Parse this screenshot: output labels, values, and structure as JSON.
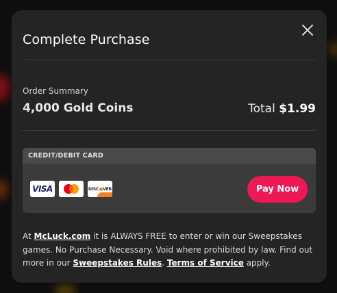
{
  "modal": {
    "title": "Complete Purchase",
    "close_icon": "close-icon"
  },
  "order": {
    "summary_label": "Order Summary",
    "product": "4,000 Gold Coins",
    "total_label": "Total",
    "total_amount": "$1.99"
  },
  "payment": {
    "method_label": "CREDIT/DEBIT CARD",
    "cards": [
      {
        "name": "visa",
        "text": "VISA",
        "icon": "visa-logo-icon"
      },
      {
        "name": "mastercard",
        "icon": "mastercard-logo-icon"
      },
      {
        "name": "discover",
        "text_a": "DISC",
        "text_b": "VER",
        "icon": "discover-logo-icon"
      }
    ],
    "pay_button": "Pay Now",
    "pay_button_color": "#ee1856"
  },
  "disclaimer": {
    "p1": "At ",
    "site_link": "McLuck.com",
    "p2": " it is ALWAYS FREE to enter or win our Sweepstakes games. No Purchase Necessary. Void where prohibited by law. Find out more in our ",
    "rules_link": "Sweepstakes Rules",
    "p3": ". ",
    "terms_link": "Terms of Service",
    "p4": " apply."
  }
}
